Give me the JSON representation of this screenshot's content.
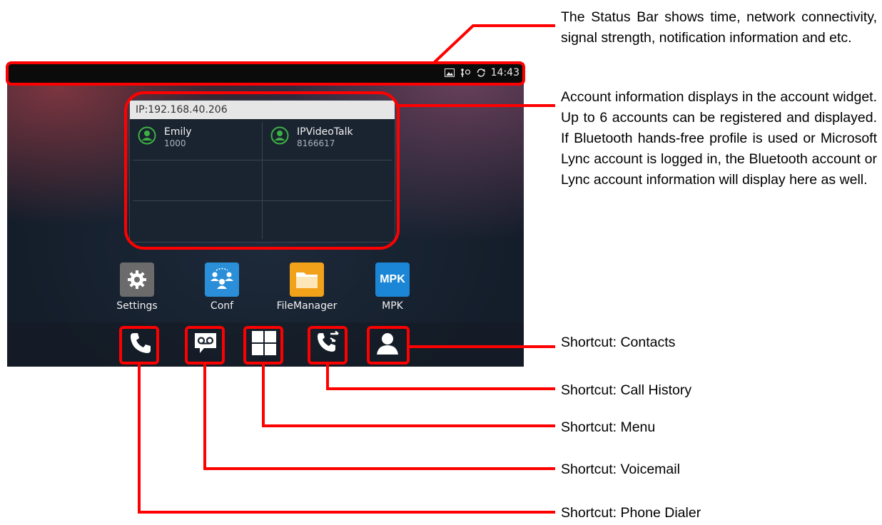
{
  "status_bar": {
    "time": "14:43"
  },
  "account_widget": {
    "ip_label": "IP:192.168.40.206",
    "accounts": [
      {
        "name": "Emily",
        "number": "1000"
      },
      {
        "name": "IPVideoTalk",
        "number": "8166617"
      }
    ]
  },
  "apps": [
    {
      "label": "Settings",
      "icon": "gear-icon"
    },
    {
      "label": "Conf",
      "icon": "conference-icon"
    },
    {
      "label": "FileManager",
      "icon": "folder-icon"
    },
    {
      "label": "MPK",
      "icon": "mpk-icon",
      "icon_text": "MPK"
    }
  ],
  "dock": [
    {
      "icon": "phone-icon"
    },
    {
      "icon": "voicemail-icon"
    },
    {
      "icon": "menu-grid-icon"
    },
    {
      "icon": "call-history-icon"
    },
    {
      "icon": "contacts-icon"
    }
  ],
  "annotations": {
    "status_bar_note": "The Status Bar shows time, network connectivity, signal strength, notification information and etc.",
    "account_note": "Account information displays in the account widget. Up to 6 accounts can be registered and displayed. If Bluetooth hands-free profile is used or Microsoft Lync account is logged in, the Bluetooth account or Lync account information will display here as well.",
    "contacts": "Shortcut: Contacts",
    "call_history": "Shortcut: Call History",
    "menu": "Shortcut: Menu",
    "voicemail": "Shortcut: Voicemail",
    "phone_dialer": "Shortcut: Phone Dialer"
  },
  "colors": {
    "highlight": "#ff0000",
    "settings_bg": "#6b6b6b",
    "conf_bg": "#2a8fd8",
    "filemanager_bg": "#f2a21a",
    "mpk_bg": "#1c86d6",
    "account_green": "#3cb043"
  }
}
